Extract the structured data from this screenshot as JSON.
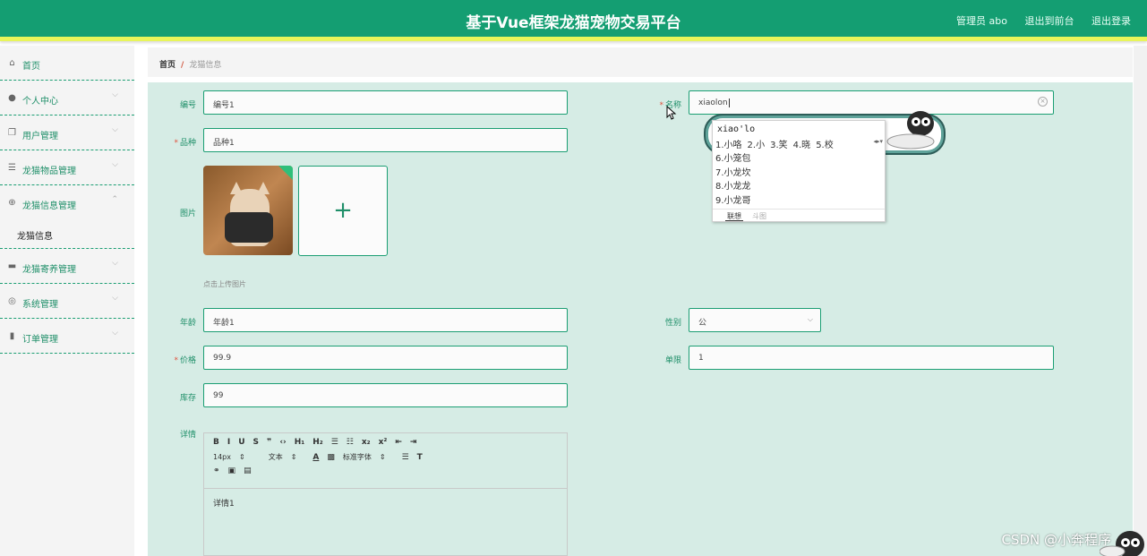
{
  "header": {
    "title": "基于Vue框架龙猫宠物交易平台",
    "admin": "管理员 abo",
    "to_front": "退出到前台",
    "logout": "退出登录",
    "brand_color": "#149e72"
  },
  "sidebar": {
    "items": [
      {
        "label": "首页",
        "icon": "home-icon"
      },
      {
        "label": "个人中心",
        "icon": "user-icon"
      },
      {
        "label": "用户管理",
        "icon": "copy-icon"
      },
      {
        "label": "龙猫物品管理",
        "icon": "sliders-icon"
      },
      {
        "label": "龙猫信息管理",
        "icon": "target-icon"
      },
      {
        "label": "龙猫寄养管理",
        "icon": "briefcase-icon"
      },
      {
        "label": "系统管理",
        "icon": "compass-icon"
      },
      {
        "label": "订单管理",
        "icon": "chart-icon"
      }
    ],
    "submenu_active": "龙猫信息"
  },
  "breadcrumb": {
    "home": "首页",
    "sep": "/",
    "current": "龙猫信息"
  },
  "form": {
    "bianhao_label": "编号",
    "bianhao_value": "编号1",
    "mingcheng_label": "名称",
    "mingcheng_value": "xiaolon",
    "pinzhong_label": "品种",
    "pinzhong_value": "品种1",
    "tupian_label": "图片",
    "upload_hint": "点击上传图片",
    "upload_plus": "+",
    "nianling_label": "年龄",
    "nianling_value": "年龄1",
    "xingbie_label": "性别",
    "xingbie_value": "公",
    "jiage_label": "价格",
    "jiage_value": "99.9",
    "danxian_label": "单限",
    "danxian_value": "1",
    "kucun_label": "库存",
    "kucun_value": "99",
    "xiangqing_label": "详情",
    "required_mark": "*"
  },
  "editor": {
    "row1": [
      "B",
      "I",
      "U",
      "S",
      "❞",
      "‹›",
      "H₁",
      "H₂",
      "☰",
      "☷",
      "x₂",
      "x²",
      "⇤",
      "⇥"
    ],
    "font_size": "14px",
    "format": "文本",
    "font_face": "标准字体",
    "content": "详情1"
  },
  "ime": {
    "pinyin": "xiao'lo",
    "row1": [
      "1.小咯",
      "2.小",
      "3.笑",
      "4.晓",
      "5.校"
    ],
    "candidates": [
      "6.小笼包",
      "7.小龙坎",
      "8.小龙龙",
      "9.小龙哥"
    ],
    "tab_active": "联想",
    "tab_other": "斗图"
  },
  "watermark": "CSDN @小奔程序"
}
